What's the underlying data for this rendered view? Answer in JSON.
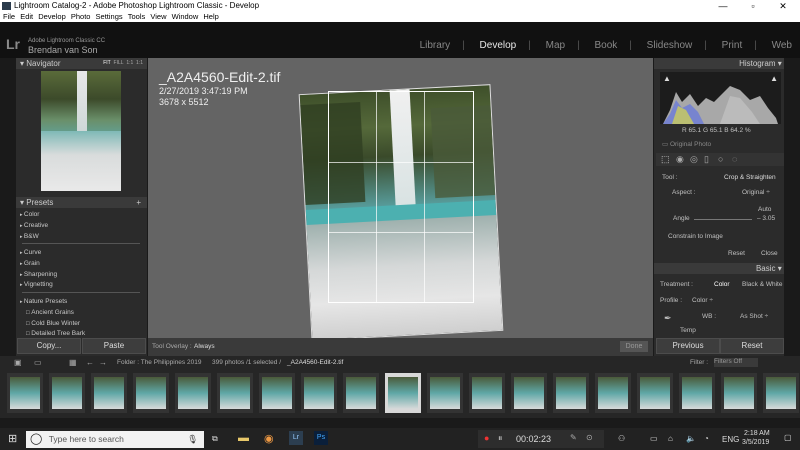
{
  "window": {
    "title": "Lightroom Catalog-2 - Adobe Photoshop Lightroom Classic - Develop",
    "controls": [
      "—",
      "▫",
      "✕"
    ]
  },
  "menu": [
    "File",
    "Edit",
    "Develop",
    "Photo",
    "Settings",
    "Tools",
    "View",
    "Window",
    "Help"
  ],
  "brand": {
    "logo": "Lr",
    "line1": "Adobe Lightroom Classic CC",
    "line2": "Brendan van Son"
  },
  "modules": [
    "Library",
    "Develop",
    "Map",
    "Book",
    "Slideshow",
    "Print",
    "Web"
  ],
  "navigator": {
    "title": "Navigator",
    "zoom": [
      "FIT",
      "FILL",
      "1:1",
      "1:1"
    ]
  },
  "presets": {
    "title": "Presets",
    "group1": [
      "Color",
      "Creative",
      "B&W"
    ],
    "group2": [
      "Curve",
      "Grain",
      "Sharpening",
      "Vignetting"
    ],
    "group3": [
      "Nature Presets"
    ],
    "nature": [
      "Ancient Grains",
      "Cold Blue Winter",
      "Detailed Tree Bark"
    ]
  },
  "left_buttons": {
    "copy": "Copy...",
    "paste": "Paste"
  },
  "photo_info": {
    "name": "_A2A4560-Edit-2.tif",
    "date": "2/27/2019 3:47:19 PM",
    "dims": "3678 x 5512"
  },
  "toolbar": {
    "label": "Tool Overlay :",
    "value": "Always",
    "done": "Done"
  },
  "histogram": {
    "title": "Histogram",
    "readout": "R 65.1  G 65.1  B 64.2 %",
    "original": "Original Photo"
  },
  "crop": {
    "tool_label": "Tool :",
    "tool_value": "Crop & Straighten",
    "aspect_label": "Aspect :",
    "aspect_value": "Original ÷",
    "auto": "Auto",
    "angle_label": "Angle",
    "angle_value": "– 3.05",
    "constrain": "Constrain to Image",
    "reset": "Reset",
    "close": "Close"
  },
  "basic": {
    "title": "Basic",
    "treatment_label": "Treatment :",
    "treatment_color": "Color",
    "treatment_bw": "Black & White",
    "profile_label": "Profile :",
    "profile_value": "Color ÷",
    "wb_label": "WB :",
    "wb_value": "As Shot ÷",
    "temp_label": "Temp"
  },
  "right_buttons": {
    "previous": "Previous",
    "reset": "Reset"
  },
  "filmbar": {
    "folder": "Folder : The Philippines 2019",
    "count": "399 photos /1 selected /",
    "file": "_A2A4560-Edit-2.tif",
    "filter_label": "Filter :",
    "filter_value": "Filters Off"
  },
  "taskbar": {
    "search": "Type here to search",
    "timer": "00:02:23",
    "lang": "ENG",
    "time": "2:18 AM",
    "date": "3/5/2019"
  }
}
